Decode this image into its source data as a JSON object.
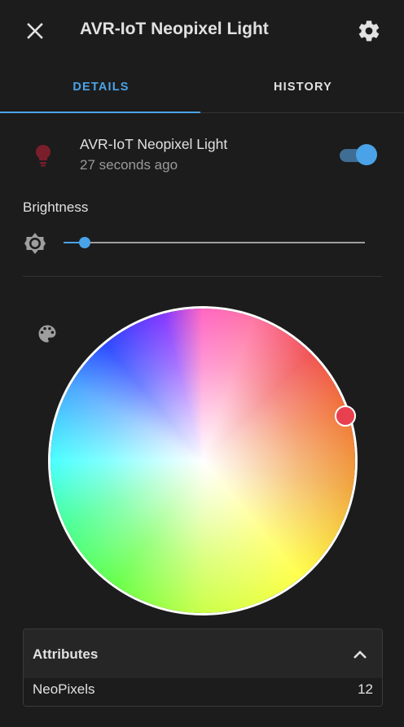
{
  "header": {
    "title": "AVR-IoT Neopixel Light",
    "close_icon": "close-icon",
    "settings_icon": "gear-icon"
  },
  "tabs": [
    {
      "label": "DETAILS",
      "active": true
    },
    {
      "label": "HISTORY",
      "active": false
    }
  ],
  "entity": {
    "name": "AVR-IoT Neopixel Light",
    "last_changed": "27 seconds ago",
    "icon": "lightbulb-icon",
    "icon_color": "#7b1e2c",
    "state_on": true
  },
  "brightness": {
    "label": "Brightness",
    "icon": "brightness-icon",
    "value_fraction": 0.07
  },
  "color_picker": {
    "icon": "palette-icon",
    "selected_color": "#e8404f"
  },
  "attributes": {
    "title": "Attributes",
    "expanded": true,
    "rows": [
      {
        "key": "NeoPixels",
        "value": "12"
      }
    ]
  },
  "colors": {
    "accent": "#4aa3e8",
    "background": "#1c1c1c"
  }
}
